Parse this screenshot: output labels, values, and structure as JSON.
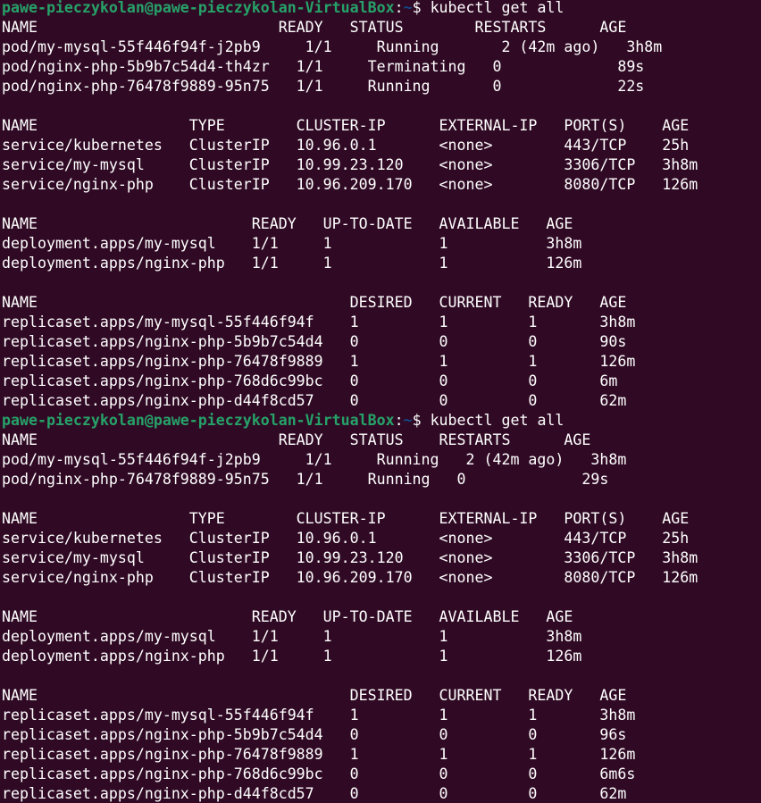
{
  "prompt": {
    "user_host": "pawe-pieczykolan@pawe-pieczykolan-VirtualBox",
    "colon": ":",
    "path": "~",
    "symbol": "$ "
  },
  "lines": [
    {
      "type": "prompt",
      "command": "kubectl get all"
    },
    {
      "type": "text",
      "text": "NAME                           READY   STATUS        RESTARTS      AGE"
    },
    {
      "type": "text",
      "text": "pod/my-mysql-55f446f94f-j2pb9     1/1     Running       2 (42m ago)   3h8m"
    },
    {
      "type": "text",
      "text": "pod/nginx-php-5b9b7c54d4-th4zr   1/1     Terminating   0             89s"
    },
    {
      "type": "text",
      "text": "pod/nginx-php-76478f9889-95n75   1/1     Running       0             22s"
    },
    {
      "type": "text",
      "text": ""
    },
    {
      "type": "text",
      "text": "NAME                 TYPE        CLUSTER-IP      EXTERNAL-IP   PORT(S)    AGE"
    },
    {
      "type": "text",
      "text": "service/kubernetes   ClusterIP   10.96.0.1       <none>        443/TCP    25h"
    },
    {
      "type": "text",
      "text": "service/my-mysql     ClusterIP   10.99.23.120    <none>        3306/TCP   3h8m"
    },
    {
      "type": "text",
      "text": "service/nginx-php    ClusterIP   10.96.209.170   <none>        8080/TCP   126m"
    },
    {
      "type": "text",
      "text": ""
    },
    {
      "type": "text",
      "text": "NAME                        READY   UP-TO-DATE   AVAILABLE   AGE"
    },
    {
      "type": "text",
      "text": "deployment.apps/my-mysql    1/1     1            1           3h8m"
    },
    {
      "type": "text",
      "text": "deployment.apps/nginx-php   1/1     1            1           126m"
    },
    {
      "type": "text",
      "text": ""
    },
    {
      "type": "text",
      "text": "NAME                                   DESIRED   CURRENT   READY   AGE"
    },
    {
      "type": "text",
      "text": "replicaset.apps/my-mysql-55f446f94f    1         1         1       3h8m"
    },
    {
      "type": "text",
      "text": "replicaset.apps/nginx-php-5b9b7c54d4   0         0         0       90s"
    },
    {
      "type": "text",
      "text": "replicaset.apps/nginx-php-76478f9889   1         1         1       126m"
    },
    {
      "type": "text",
      "text": "replicaset.apps/nginx-php-768d6c99bc   0         0         0       6m"
    },
    {
      "type": "text",
      "text": "replicaset.apps/nginx-php-d44f8cd57    0         0         0       62m"
    },
    {
      "type": "prompt",
      "command": "kubectl get all"
    },
    {
      "type": "text",
      "text": "NAME                           READY   STATUS    RESTARTS      AGE"
    },
    {
      "type": "text",
      "text": "pod/my-mysql-55f446f94f-j2pb9     1/1     Running   2 (42m ago)   3h8m"
    },
    {
      "type": "text",
      "text": "pod/nginx-php-76478f9889-95n75   1/1     Running   0             29s"
    },
    {
      "type": "text",
      "text": ""
    },
    {
      "type": "text",
      "text": "NAME                 TYPE        CLUSTER-IP      EXTERNAL-IP   PORT(S)    AGE"
    },
    {
      "type": "text",
      "text": "service/kubernetes   ClusterIP   10.96.0.1       <none>        443/TCP    25h"
    },
    {
      "type": "text",
      "text": "service/my-mysql     ClusterIP   10.99.23.120    <none>        3306/TCP   3h8m"
    },
    {
      "type": "text",
      "text": "service/nginx-php    ClusterIP   10.96.209.170   <none>        8080/TCP   126m"
    },
    {
      "type": "text",
      "text": ""
    },
    {
      "type": "text",
      "text": "NAME                        READY   UP-TO-DATE   AVAILABLE   AGE"
    },
    {
      "type": "text",
      "text": "deployment.apps/my-mysql    1/1     1            1           3h8m"
    },
    {
      "type": "text",
      "text": "deployment.apps/nginx-php   1/1     1            1           126m"
    },
    {
      "type": "text",
      "text": ""
    },
    {
      "type": "text",
      "text": "NAME                                   DESIRED   CURRENT   READY   AGE"
    },
    {
      "type": "text",
      "text": "replicaset.apps/my-mysql-55f446f94f    1         1         1       3h8m"
    },
    {
      "type": "text",
      "text": "replicaset.apps/nginx-php-5b9b7c54d4   0         0         0       96s"
    },
    {
      "type": "text",
      "text": "replicaset.apps/nginx-php-76478f9889   1         1         1       126m"
    },
    {
      "type": "text",
      "text": "replicaset.apps/nginx-php-768d6c99bc   0         0         0       6m6s"
    },
    {
      "type": "text",
      "text": "replicaset.apps/nginx-php-d44f8cd57    0         0         0       62m"
    }
  ]
}
